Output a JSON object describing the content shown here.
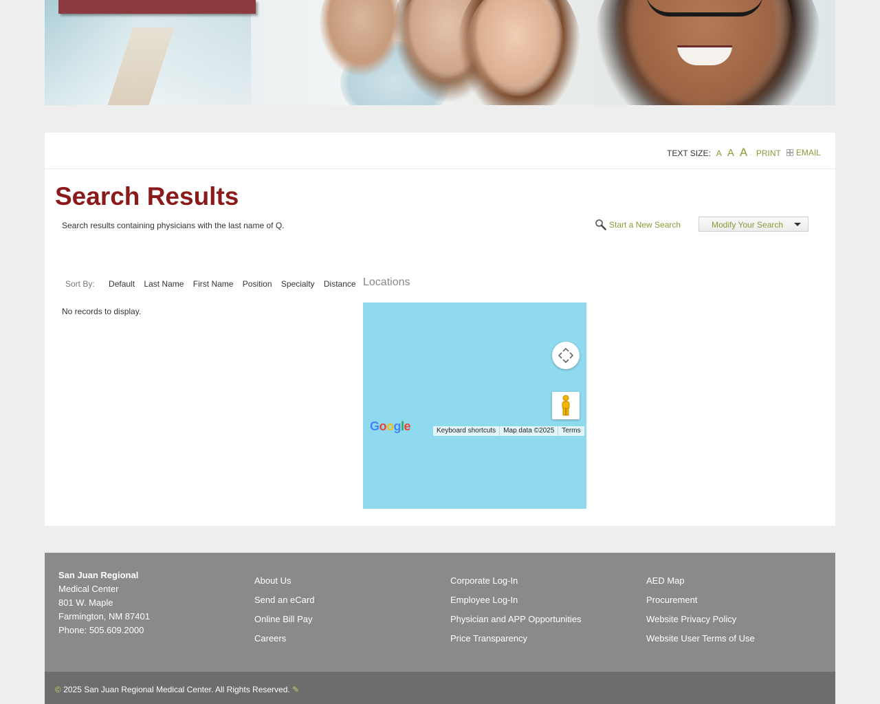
{
  "toolbar": {
    "text_size_label": "TEXT SIZE:",
    "size_small": "A",
    "size_medium": "A",
    "size_large": "A",
    "print_label": "PRINT",
    "email_label": "EMAIL"
  },
  "page": {
    "title": "Search Results",
    "description": "Search results containing physicians with the last name of Q.",
    "new_search_label": "Start a New Search",
    "modify_search_label": "Modify Your Search"
  },
  "sort": {
    "label": "Sort By:",
    "options": [
      "Default",
      "Last Name",
      "First Name",
      "Position",
      "Specialty",
      "Distance"
    ]
  },
  "results": {
    "empty_message": "No records to display."
  },
  "locations": {
    "title": "Locations",
    "map": {
      "logo": "Google",
      "keyboard_shortcuts": "Keyboard shortcuts",
      "map_data": "Map data ©2025",
      "terms": "Terms"
    }
  },
  "footer": {
    "address": {
      "org_line": "San Juan Regional",
      "line2": "Medical Center",
      "street": "801 W. Maple",
      "city": "Farmington, NM 87401",
      "phone": "Phone: 505.609.2000"
    },
    "col1": [
      "About Us",
      "Send an eCard",
      "Online Bill Pay",
      "Careers"
    ],
    "col2": [
      "Corporate Log-In",
      "Employee Log-In",
      "Physician and APP Opportunities",
      "Price Transparency"
    ],
    "col3": [
      "AED Map",
      "Procurement",
      "Website Privacy Policy",
      "Website User Terms of Use"
    ],
    "copyright": "2025 San Juan Regional Medical Center. All Rights Reserved."
  },
  "colors": {
    "title_red": "#8b1a1a",
    "link_green": "#8a9a3a",
    "footer_gray": "#8a8a8a",
    "map_water": "#8fdaef"
  }
}
